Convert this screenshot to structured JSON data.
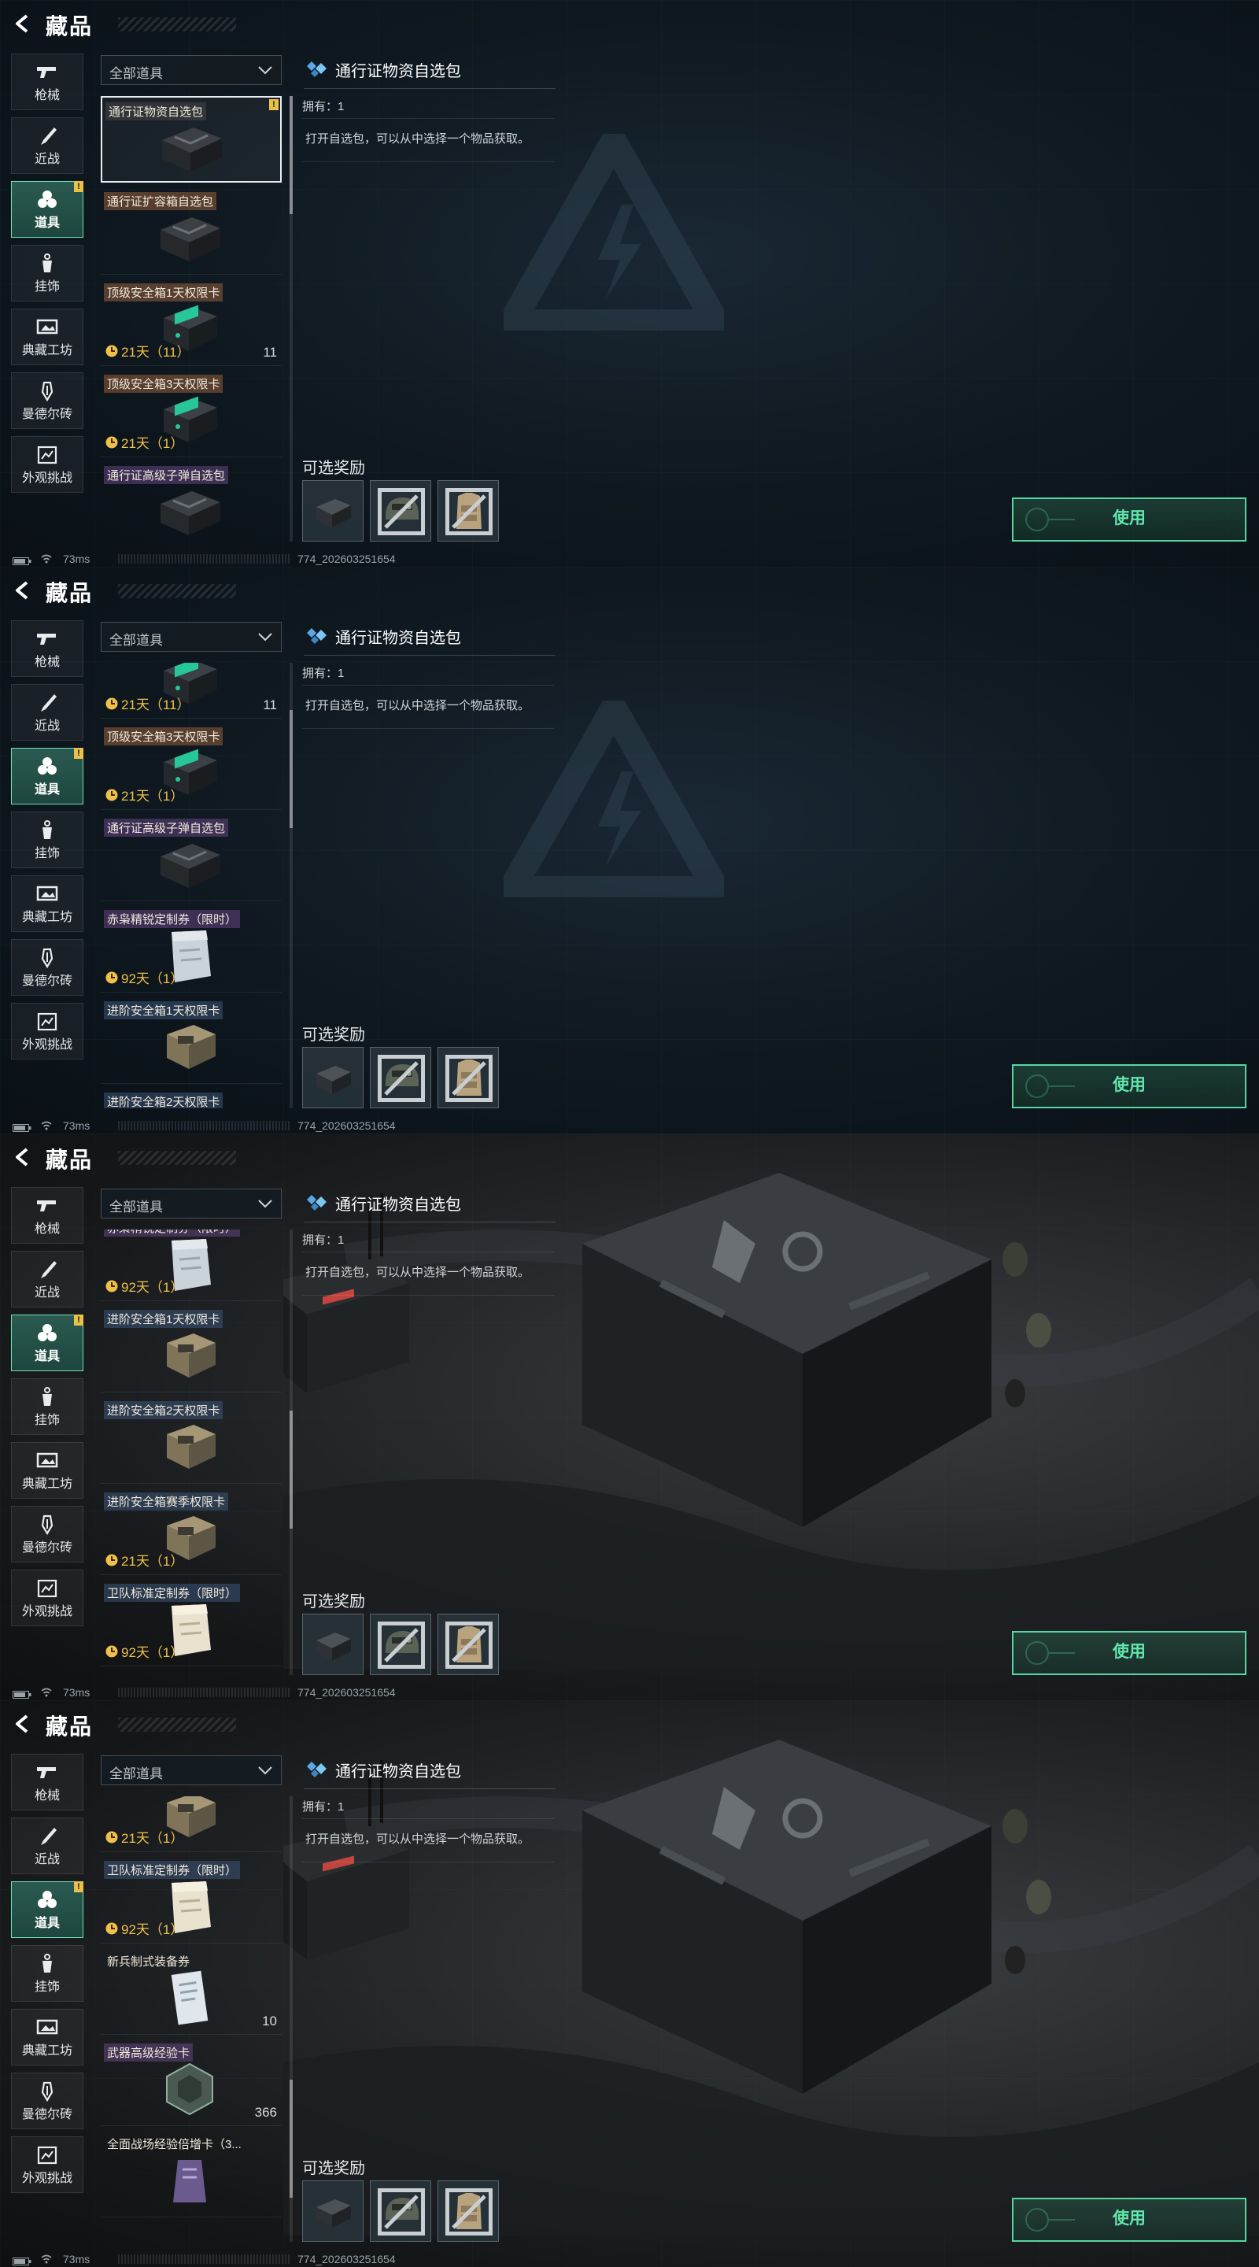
{
  "header": {
    "title": "藏品"
  },
  "nav": {
    "items": [
      {
        "label": "枪械",
        "icon": "gun-icon"
      },
      {
        "label": "近战",
        "icon": "knife-icon"
      },
      {
        "label": "道具",
        "icon": "items-icon",
        "active": true,
        "badge": "!"
      },
      {
        "label": "挂饰",
        "icon": "charm-icon"
      },
      {
        "label": "典藏工坊",
        "icon": "workshop-icon"
      },
      {
        "label": "曼德尔砖",
        "icon": "brick-icon"
      },
      {
        "label": "外观挑战",
        "icon": "challenge-icon"
      }
    ]
  },
  "filter": {
    "label": "全部道具"
  },
  "detail": {
    "title": "通行证物资自选包",
    "owned": "拥有：1",
    "description": "打开自选包，可以从中选择一个物品获取。",
    "rewards_label": "可选奖励",
    "use_label": "使用"
  },
  "status": {
    "ping": "73ms",
    "session": "774_202603251654"
  },
  "frames": [
    {
      "background": "dark-emblem",
      "items": [
        {
          "label": "通行证物资自选包",
          "tag": "plain",
          "image": "black-case",
          "selected": true,
          "excl": "!"
        },
        {
          "label": "通行证扩容箱自选包",
          "tag": "orange",
          "image": "black-case"
        },
        {
          "label": "顶级安全箱1天权限卡",
          "tag": "orange",
          "image": "green-device",
          "timer": "21天（11）",
          "count": "11"
        },
        {
          "label": "顶级安全箱3天权限卡",
          "tag": "orange",
          "image": "green-device",
          "timer": "21天（1）"
        },
        {
          "label": "通行证高级子弹自选包",
          "tag": "purple",
          "image": "black-case"
        }
      ]
    },
    {
      "background": "dark-emblem",
      "items": [
        {
          "label": "",
          "tag": "none",
          "image": "green-device",
          "timer": "21天（11）",
          "count": "11",
          "partial": true
        },
        {
          "label": "顶级安全箱3天权限卡",
          "tag": "orange",
          "image": "green-device",
          "timer": "21天（1）"
        },
        {
          "label": "通行证高级子弹自选包",
          "tag": "purple",
          "image": "black-case"
        },
        {
          "label": "赤枭精锐定制券（限时）",
          "tag": "purple",
          "image": "white-bag",
          "timer": "92天（1）"
        },
        {
          "label": "进阶安全箱1天权限卡",
          "tag": "blue",
          "image": "tan-device"
        },
        {
          "label": "进阶安全箱2天权限卡",
          "tag": "blue",
          "image": "tan-device"
        }
      ]
    },
    {
      "background": "photo",
      "items": [
        {
          "label": "赤枭精锐定制券（限时）",
          "tag": "purple",
          "image": "white-bag",
          "timer": "92天（1）"
        },
        {
          "label": "进阶安全箱1天权限卡",
          "tag": "blue",
          "image": "tan-device"
        },
        {
          "label": "进阶安全箱2天权限卡",
          "tag": "blue",
          "image": "tan-device"
        },
        {
          "label": "进阶安全箱赛季权限卡",
          "tag": "blue",
          "image": "tan-device",
          "timer": "21天（1）"
        },
        {
          "label": "卫队标准定制券（限时）",
          "tag": "blue",
          "image": "paper-bag",
          "timer": "92天（1）"
        }
      ]
    },
    {
      "background": "photo",
      "items": [
        {
          "label": "进阶安全箱赛季权限卡",
          "tag": "blue",
          "image": "tan-device",
          "timer": "21天（1）"
        },
        {
          "label": "卫队标准定制券（限时）",
          "tag": "blue",
          "image": "paper-bag",
          "timer": "92天（1）"
        },
        {
          "label": "新兵制式装备券",
          "tag": "none",
          "image": "paper-sheet",
          "count": "10"
        },
        {
          "label": "武器高级经验卡",
          "tag": "purple",
          "image": "hex-card",
          "count": "366"
        },
        {
          "label": "全面战场经验倍增卡（3...",
          "tag": "none",
          "image": "purple-card"
        }
      ]
    }
  ],
  "colors": {
    "accent": "#57d6a2",
    "timer": "#f0c04a",
    "badge": "#e9c04a"
  }
}
